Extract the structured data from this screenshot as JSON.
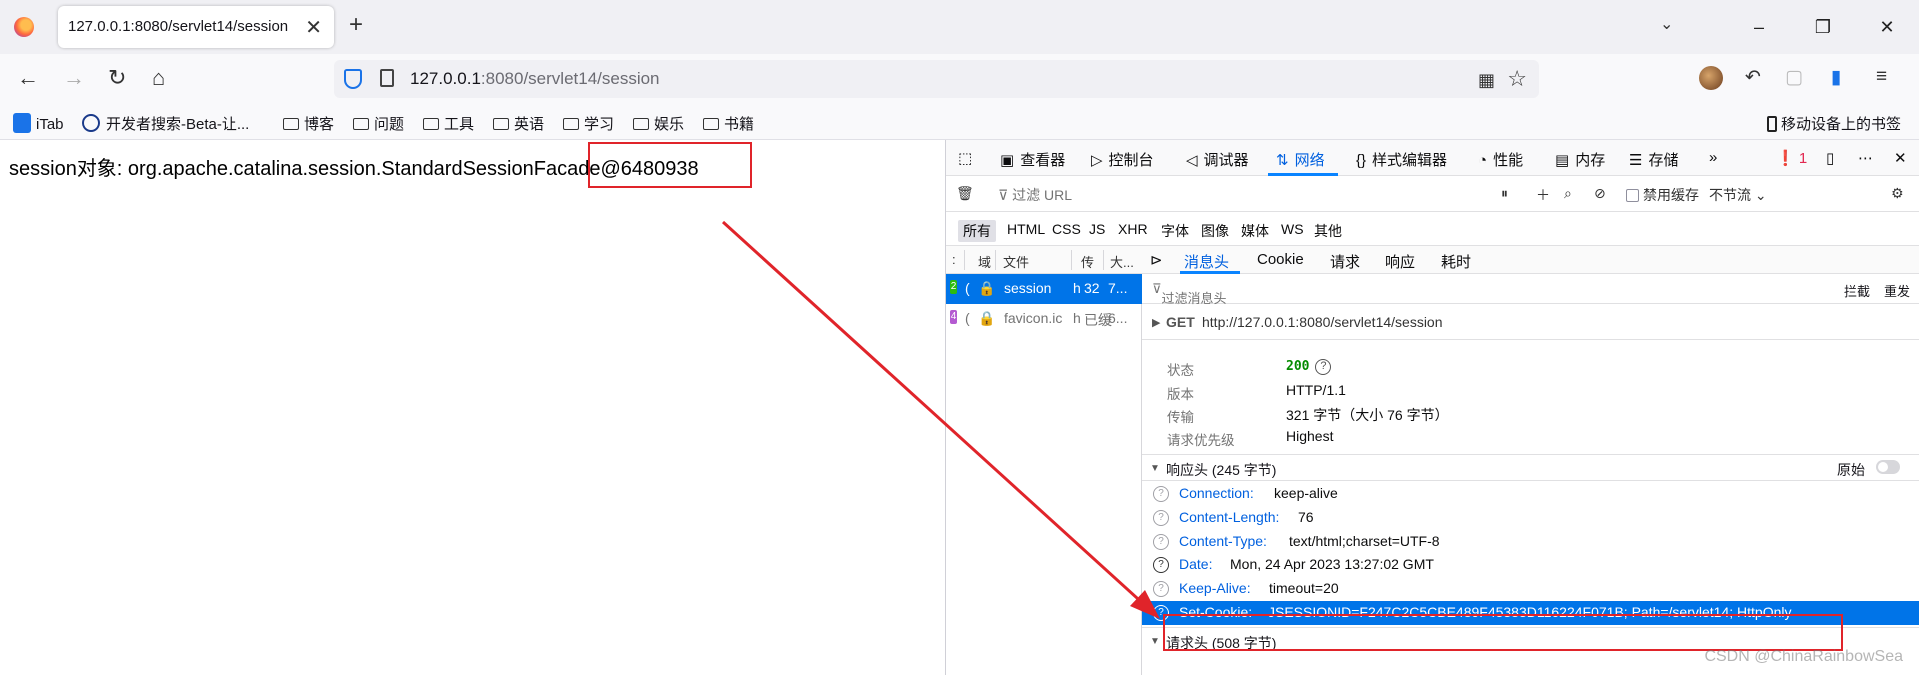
{
  "browser": {
    "tab": {
      "title": "127.0.0.1:8080/servlet14/session",
      "close": "✕"
    },
    "new_tab": "+",
    "window_buttons": {
      "list": "⌄",
      "minimize": "–",
      "restore": "❐",
      "close": "✕"
    },
    "url": {
      "host": "127.0.0.1",
      "rest": ":8080/servlet14/session"
    },
    "nav": {
      "back": "←",
      "forward": "→",
      "reload": "↻",
      "home": "⌂",
      "star": "☆",
      "qr": "▦",
      "undo": "↶",
      "ext": "▢",
      "menu": "≡"
    }
  },
  "bookmarks": {
    "items": [
      "iTab",
      "开发者搜索-Beta-让...",
      "博客",
      "问题",
      "工具",
      "英语",
      "学习",
      "娱乐",
      "书籍"
    ],
    "mobile": "移动设备上的书签"
  },
  "page": {
    "text": "session对象: org.apache.catalina.session.StandardSessionFacade@6480938"
  },
  "devtools": {
    "tools": [
      "查看器",
      "控制台",
      "调试器",
      "网络",
      "样式编辑器",
      "性能",
      "内存",
      "存储"
    ],
    "active_tool": "网络",
    "error_count": "1",
    "filter_placeholder": "过滤 URL",
    "disable_cache": "禁用缓存",
    "throttle": "不节流 ⌄",
    "types": [
      "所有",
      "HTML",
      "CSS",
      "JS",
      "XHR",
      "字体",
      "图像",
      "媒体",
      "WS",
      "其他"
    ],
    "request_list": {
      "headers": [
        ":",
        "域",
        "文件",
        "传",
        "大..."
      ],
      "rows": [
        {
          "status": "2",
          "domain": "(",
          "file": "session",
          "type": "h",
          "transfer": "32",
          "size": "7..."
        },
        {
          "status": "4",
          "domain": "(",
          "file": "favicon.ic",
          "type": "h",
          "transfer": "已缓",
          "size": "6..."
        }
      ]
    },
    "detail": {
      "tabs": [
        "消息头",
        "Cookie",
        "请求",
        "响应",
        "耗时"
      ],
      "filter_placeholder": "过滤消息头",
      "block": "拦截",
      "resend": "重发",
      "method": "GET",
      "request_url": "http://127.0.0.1:8080/servlet14/session",
      "summary": [
        {
          "label": "状态",
          "value": "200"
        },
        {
          "label": "版本",
          "value": "HTTP/1.1"
        },
        {
          "label": "传输",
          "value": "321 字节（大小 76 字节）"
        },
        {
          "label": "请求优先级",
          "value": "Highest"
        }
      ],
      "response_section": "响应头 (245 字节)",
      "raw_label": "原始",
      "response_headers": [
        {
          "name": "Connection:",
          "value": "keep-alive"
        },
        {
          "name": "Content-Length:",
          "value": "76"
        },
        {
          "name": "Content-Type:",
          "value": "text/html;charset=UTF-8"
        },
        {
          "name": "Date:",
          "value": "Mon, 24 Apr 2023 13:27:02 GMT"
        },
        {
          "name": "Keep-Alive:",
          "value": "timeout=20"
        },
        {
          "name": "Set-Cookie:",
          "value": "JSESSIONID=F247C2C5CBE489F45383D116224F071B; Path=/servlet14; HttpOnly"
        }
      ],
      "request_section": "请求头 (508 字节)"
    }
  },
  "watermark": "CSDN @ChinaRainbowSea",
  "colors": {
    "accent": "#0074e8",
    "annotation_red": "#e0242a"
  }
}
